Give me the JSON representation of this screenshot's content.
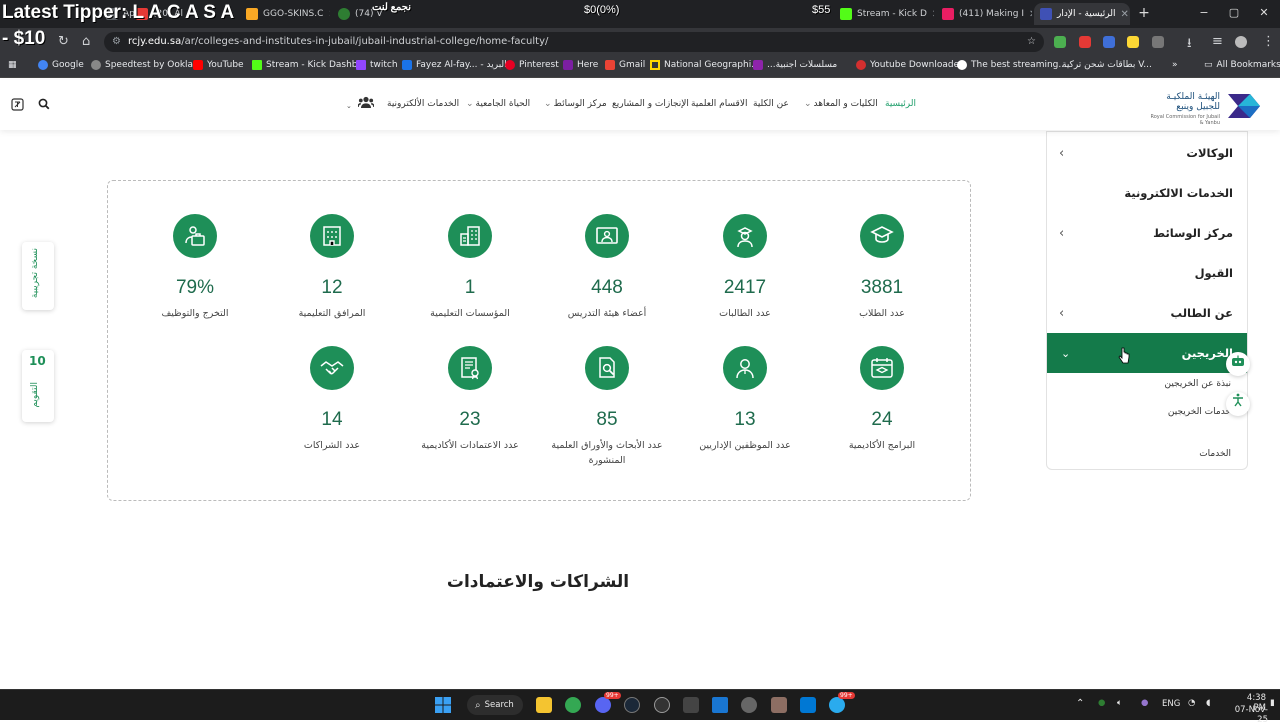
{
  "browser": {
    "overlay": {
      "title": "Latest Tipper: L A C A S A",
      "amount": "- $10",
      "arabic_top": "نجمع لنت",
      "balance": "$0(0%)",
      "score": "$55"
    },
    "tabs": [
      {
        "label": "Ap",
        "color": "#5f6368"
      },
      {
        "label": "(20) Al",
        "color": "#e53935"
      },
      {
        "label": "GGO-SKINS.C",
        "color": "#f9a825"
      },
      {
        "label": "(74) V",
        "color": "#2e7d32"
      },
      {
        "label": "Stream - Kick D",
        "color": "#53fc18"
      },
      {
        "label": "(411) Making I",
        "color": "#e91e63"
      },
      {
        "label": "الرئيسية - الإدار",
        "color": "#3f51b5"
      }
    ],
    "window_buttons": [
      "−",
      "▢",
      "✕"
    ],
    "url": {
      "host": "rcjy.edu.sa",
      "path": "/ar/colleges-and-institutes-in-jubail/jubail-industrial-college/home-faculty/"
    },
    "bookmarks": [
      {
        "label": "Google",
        "color": "#4285f4"
      },
      {
        "label": "Speedtest by Ookla...",
        "color": "#888888"
      },
      {
        "label": "YouTube",
        "color": "#ff0000"
      },
      {
        "label": "Stream - Kick Dashb...",
        "color": "#53fc18"
      },
      {
        "label": "twitch",
        "color": "#9146ff"
      },
      {
        "label": "Fayez Al-fay... - البريد",
        "color": "#1a73e8"
      },
      {
        "label": "Pinterest",
        "color": "#e60023"
      },
      {
        "label": "Here",
        "color": "#7b1fa2"
      },
      {
        "label": "Gmail",
        "color": "#ea4335"
      },
      {
        "label": "National Geographi...",
        "color": "#ffd600"
      },
      {
        "label": "...مسلسلات اجنبية",
        "color": "#8e24aa"
      },
      {
        "label": "Youtube Downloader",
        "color": "#d32f2f"
      },
      {
        "label": "The best streaming...",
        "color": "#ffffff"
      },
      {
        "label": "بطاقات شحن تركية V...",
        "color": "#555555"
      }
    ],
    "all_bookmarks": "All Bookmarks"
  },
  "site": {
    "menu": [
      {
        "label": "الرئيسية",
        "active": true
      },
      {
        "label": "الكليات و المعاهد",
        "dropdown": true
      },
      {
        "label": "عن الكلية",
        "dropdown": true
      },
      {
        "label": "الاقسام العلمية"
      },
      {
        "label": "الإنجازات و المشاريع"
      },
      {
        "label": "مركز الوسائط",
        "dropdown": true
      },
      {
        "label": "الحياة الجامعية",
        "dropdown": true
      },
      {
        "label": "الخدمات الألكترونية"
      }
    ],
    "logo": {
      "name": "الهيئـة الملكيـة للجبيل وينبع",
      "sub": "Royal Commission for Jubail & Yanbu"
    },
    "stats": [
      {
        "value": "3881",
        "label": "عدد الطلاب",
        "icon": "graduate-icon"
      },
      {
        "value": "2417",
        "label": "عدد الطالبات",
        "icon": "female-graduate-icon"
      },
      {
        "value": "448",
        "label": "أعضاء هيئة التدريس",
        "icon": "presentation-icon"
      },
      {
        "value": "1",
        "label": "المؤسسات التعليمية",
        "icon": "institution-building-icon"
      },
      {
        "value": "12",
        "label": "المرافق التعليمية",
        "icon": "facility-building-icon"
      },
      {
        "value": "79%",
        "label": "التخرج والتوظيف",
        "icon": "employment-icon"
      },
      {
        "value": "24",
        "label": "البرامج الأكاديمية",
        "icon": "academic-program-icon"
      },
      {
        "value": "13",
        "label": "عدد الموظفين الإداريين",
        "icon": "admin-staff-icon"
      },
      {
        "value": "85",
        "label": "عدد الأبحاث والأوراق العلمية المنشورة",
        "icon": "research-icon"
      },
      {
        "value": "23",
        "label": "عدد الاعتمادات الأكاديمية",
        "icon": "accreditation-icon"
      },
      {
        "value": "14",
        "label": "عدد الشراكات",
        "icon": "handshake-icon"
      }
    ],
    "section_title": "الشراكات والاعتمادات",
    "sidebar": [
      {
        "label": "الوكالات",
        "chevron": true
      },
      {
        "label": "الخدمات الالكترونية",
        "chevron": false
      },
      {
        "label": "مركز الوسائط",
        "chevron": true
      },
      {
        "label": "القبول",
        "chevron": false
      },
      {
        "label": "عن الطالب",
        "chevron": true
      },
      {
        "label": "الخريجين",
        "open": true
      }
    ],
    "sidebar_sub": [
      "نبذة عن الخريجين",
      "خدمات الخريجين"
    ],
    "sidebar_last": "الخدمات",
    "left_tabs": {
      "trial": "نسخة تجريبية",
      "calendar": "التقويم",
      "calendar_date": "10"
    },
    "brand_color": "#1e8f58"
  },
  "taskbar": {
    "search": "Search",
    "lang": "ENG",
    "time": "4:38 PM",
    "date": "07-Nov-25",
    "badge_a": "99+",
    "badge_b": "99+"
  }
}
